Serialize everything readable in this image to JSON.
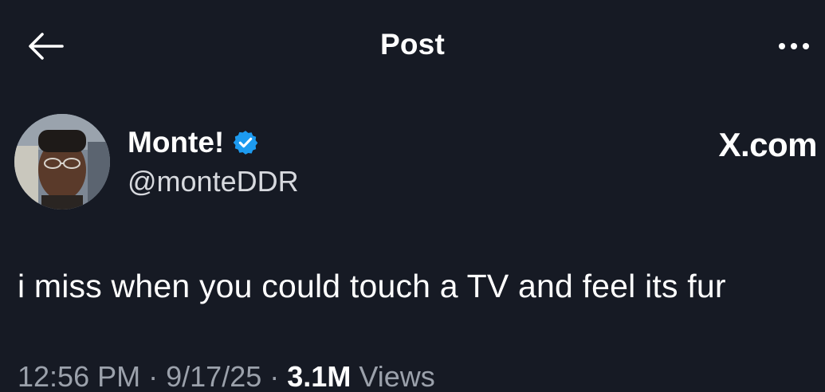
{
  "header": {
    "title": "Post",
    "back_icon": "arrow-left-icon",
    "more_icon": "more-horizontal-icon"
  },
  "author": {
    "display_name": "Monte!",
    "verified": true,
    "verified_icon": "verified-badge-icon",
    "handle": "@monteDDR"
  },
  "watermark": "X.com",
  "post": {
    "text": "i miss when you could touch a TV and feel its fur"
  },
  "meta": {
    "time": "12:56 PM",
    "separator": "·",
    "date": "9/17/25",
    "views_count": "3.1M",
    "views_label": "Views"
  },
  "colors": {
    "background": "#161a24",
    "text": "#ffffff",
    "secondary_text": "#9ba1ab",
    "verified_blue": "#1d9bf0"
  }
}
